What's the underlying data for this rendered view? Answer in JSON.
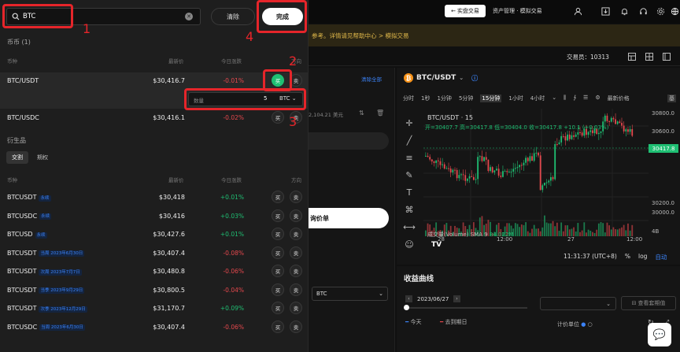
{
  "topbar": {
    "back_trade": "实盘交易",
    "assets": "资产管理 · 模拟交易"
  },
  "banner": {
    "text": "参考。详情请见帮助中心 > 模拟交易"
  },
  "infobar": {
    "trader": "交易员：10313"
  },
  "mid": {
    "clear_all": "清除全部",
    "usd": "2,104.21 美元",
    "order_btn": "询价单",
    "select_value": "BTC"
  },
  "chart": {
    "pair": "BTC/USDT",
    "timeframes": [
      "分时",
      "1秒",
      "1分钟",
      "5分钟",
      "15分钟",
      "1小时",
      "4小时"
    ],
    "active_tf": "15分钟",
    "price_type": "最新价格",
    "indicator_cut": "基",
    "ohlc_title": "BTC/USDT · 15",
    "ohlc_line": "开=30407.7 高=30417.8 低=30404.0 收=30417.8 +10.1 (+0.03%)",
    "volume_label": "成交量(Volume) SMA 9",
    "volume_value": "84.022M",
    "last_price": "30417.8",
    "price_ticks": [
      "30800.0",
      "30600.0",
      "30400.0",
      "30200.0",
      "30000.0",
      "4B"
    ],
    "time_ticks": [
      "28",
      "12:00",
      "27",
      "12:00"
    ],
    "clock": "11:31:37 (UTC+8)",
    "pct": "%",
    "log": "log",
    "auto": "自动"
  },
  "profit": {
    "title": "收益曲线",
    "date": "2023/06/27",
    "legend_today": "今天",
    "legend_ma": "去到期日",
    "view_hedge": "查看套期值",
    "unit_label": "计价单位"
  },
  "dropdown": {
    "search_value": "BTC",
    "clear_label": "清除",
    "done_label": "完成",
    "spot_title": "币币 (1)",
    "col_coin": "币种",
    "col_price": "最新价",
    "col_change": "今日涨跌",
    "col_dir": "方向",
    "buy": "买",
    "sell": "卖",
    "spot": [
      {
        "symbol": "BTC/USDT",
        "price": "$30,416.7",
        "change": "-0.01%",
        "dir": "neg",
        "buy_active": true
      },
      {
        "symbol": "BTC/USDC",
        "price": "$30,416.1",
        "change": "-0.02%",
        "dir": "neg",
        "buy_active": false
      }
    ],
    "qty_label": "数量",
    "qty_value": "5",
    "qty_unit": "BTC",
    "deriv_title": "衍生品",
    "tab_futures": "交割",
    "tab_options": "期权",
    "deriv": [
      {
        "symbol": "BTCUSDT",
        "tag": "永续",
        "price": "$30,418",
        "change": "+0.01%",
        "dir": "pos"
      },
      {
        "symbol": "BTCUSDC",
        "tag": "永续",
        "price": "$30,416",
        "change": "+0.03%",
        "dir": "pos"
      },
      {
        "symbol": "BTCUSD",
        "tag": "永续",
        "price": "$30,427.6",
        "change": "+0.01%",
        "dir": "pos"
      },
      {
        "symbol": "BTCUSDT",
        "tag": "当周 2023年6月30日",
        "price": "$30,407.4",
        "change": "-0.08%",
        "dir": "neg"
      },
      {
        "symbol": "BTCUSDT",
        "tag": "次周 2023年7月7日",
        "price": "$30,480.8",
        "change": "-0.06%",
        "dir": "neg"
      },
      {
        "symbol": "BTCUSDT",
        "tag": "当季 2023年9月29日",
        "price": "$30,800.5",
        "change": "-0.04%",
        "dir": "neg"
      },
      {
        "symbol": "BTCUSDT",
        "tag": "次季 2023年12月29日",
        "price": "$31,170.7",
        "change": "+0.09%",
        "dir": "pos"
      },
      {
        "symbol": "BTCUSDC",
        "tag": "当周 2023年6月30日",
        "price": "$30,407.4",
        "change": "-0.06%",
        "dir": "neg"
      }
    ]
  },
  "annotations": [
    "1",
    "2",
    "3",
    "4"
  ]
}
